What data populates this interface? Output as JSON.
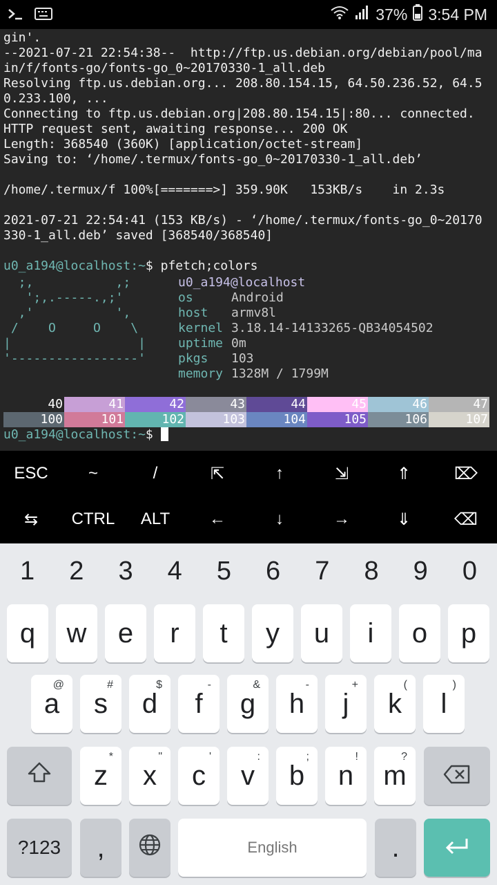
{
  "status_bar": {
    "battery": "37%",
    "time": "3:54 PM"
  },
  "terminal": {
    "lines": [
      "gin'.",
      "--2021-07-21 22:54:38--  http://ftp.us.debian.org/debian/pool/ma",
      "in/f/fonts-go/fonts-go_0~20170330-1_all.deb",
      "Resolving ftp.us.debian.org... 208.80.154.15, 64.50.236.52, 64.5",
      "0.233.100, ...",
      "Connecting to ftp.us.debian.org|208.80.154.15|:80... connected.",
      "HTTP request sent, awaiting response... 200 OK",
      "Length: 368540 (360K) [application/octet-stream]",
      "Saving to: ‘/home/.termux/fonts-go_0~20170330-1_all.deb’",
      "",
      "/home/.termux/f 100%[=======>] 359.90K   153KB/s    in 2.3s",
      "",
      "2021-07-21 22:54:41 (153 KB/s) - ‘/home/.termux/fonts-go_0~20170",
      "330-1_all.deb’ saved [368540/368540]",
      ""
    ],
    "prompt_user": "u0_a194@localhost",
    "prompt_path": ":~",
    "prompt_symbol": "$",
    "command": " pfetch;colors",
    "pfetch": {
      "logo": [
        "  ;,           ,;",
        "   ';,.-----.,;'",
        "  ,'           ',",
        " /    O     O    \\",
        "|                 |",
        "'-----------------'"
      ],
      "title": "u0_a194@localhost",
      "info": [
        {
          "key": "os",
          "value": "Android"
        },
        {
          "key": "host",
          "value": "armv8l"
        },
        {
          "key": "kernel",
          "value": "3.18.14-14133265-QB34054502"
        },
        {
          "key": "uptime",
          "value": "0m"
        },
        {
          "key": "pkgs",
          "value": "103"
        },
        {
          "key": "memory",
          "value": "1328M / 1799M"
        }
      ]
    },
    "colors_row1": [
      {
        "label": "40",
        "color": "#262626"
      },
      {
        "label": "41",
        "color": "#c79fd6"
      },
      {
        "label": "42",
        "color": "#8f6ed8"
      },
      {
        "label": "43",
        "color": "#8a8a9a"
      },
      {
        "label": "44",
        "color": "#5f4a96"
      },
      {
        "label": "45",
        "color": "#ffbff5"
      },
      {
        "label": "46",
        "color": "#9fc4d6"
      },
      {
        "label": "47",
        "color": "#b5b5b5"
      }
    ],
    "colors_row2": [
      {
        "label": "100",
        "color": "#5c6770"
      },
      {
        "label": "101",
        "color": "#d17a99"
      },
      {
        "label": "102",
        "color": "#62b5b0"
      },
      {
        "label": "103",
        "color": "#c3c2dc"
      },
      {
        "label": "104",
        "color": "#6a86c0"
      },
      {
        "label": "105",
        "color": "#7e5cc8"
      },
      {
        "label": "106",
        "color": "#7c8d98"
      },
      {
        "label": "107",
        "color": "#d6d4cc"
      }
    ]
  },
  "extra_keys": {
    "row1": [
      "ESC",
      "~",
      "/",
      "⇱",
      "↑",
      "⇲",
      "⇑",
      "⌦"
    ],
    "row2": [
      "⇆",
      "CTRL",
      "ALT",
      "←",
      "↓",
      "→",
      "⇓",
      "⌫"
    ]
  },
  "keyboard": {
    "numbers": [
      "1",
      "2",
      "3",
      "4",
      "5",
      "6",
      "7",
      "8",
      "9",
      "0"
    ],
    "row1": [
      "q",
      "w",
      "e",
      "r",
      "t",
      "y",
      "u",
      "i",
      "o",
      "p"
    ],
    "row2": [
      {
        "k": "a",
        "h": "@"
      },
      {
        "k": "s",
        "h": "#"
      },
      {
        "k": "d",
        "h": "$"
      },
      {
        "k": "f",
        "h": "-"
      },
      {
        "k": "g",
        "h": "&"
      },
      {
        "k": "h",
        "h": "-"
      },
      {
        "k": "j",
        "h": "+"
      },
      {
        "k": "k",
        "h": "("
      },
      {
        "k": "l",
        "h": ")"
      }
    ],
    "row3": [
      {
        "k": "z",
        "h": "*"
      },
      {
        "k": "x",
        "h": "\""
      },
      {
        "k": "c",
        "h": "'"
      },
      {
        "k": "v",
        "h": ":"
      },
      {
        "k": "b",
        "h": ";"
      },
      {
        "k": "n",
        "h": "!"
      },
      {
        "k": "m",
        "h": "?"
      }
    ],
    "symbols_label": "?123",
    "comma": ",",
    "space_label": "English",
    "period": "."
  }
}
